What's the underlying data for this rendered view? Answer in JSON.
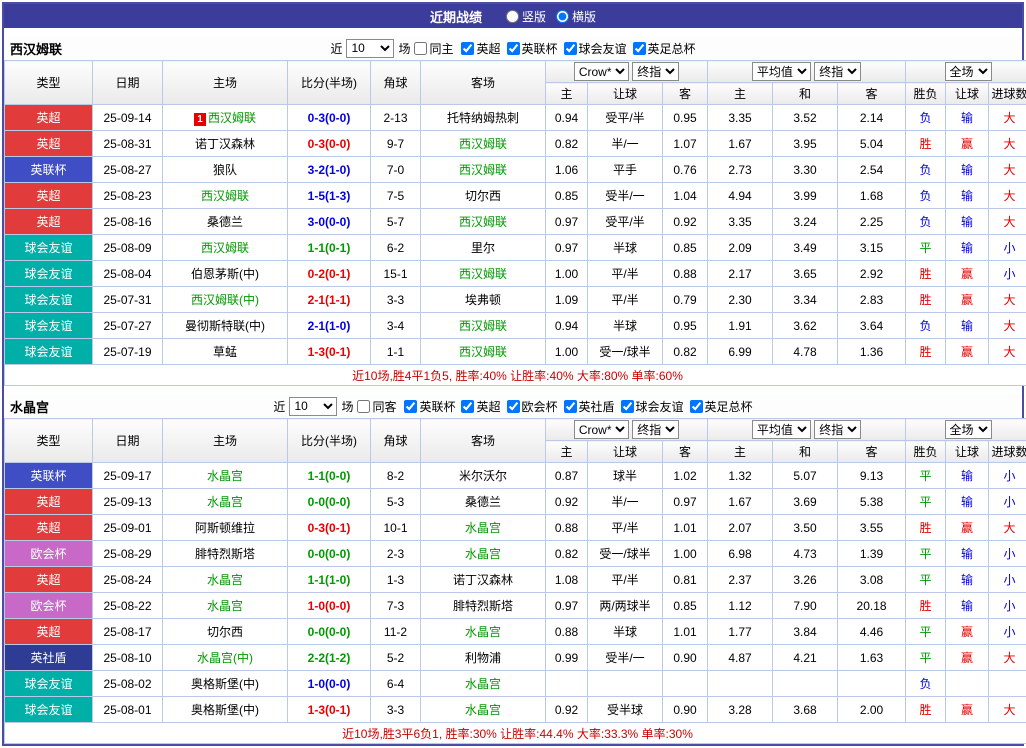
{
  "titlebar": {
    "title": "近期战绩",
    "layout_options": [
      {
        "label": "竖版",
        "selected": false
      },
      {
        "label": "横版",
        "selected": true
      }
    ]
  },
  "controls": {
    "near": "近",
    "count": "10",
    "matches": "场",
    "odds_source": "Crow*",
    "final_index": "终指",
    "average": "平均值",
    "full_match": "全场"
  },
  "columns": {
    "type": "类型",
    "date": "日期",
    "home": "主场",
    "score": "比分(半场)",
    "corner": "角球",
    "away": "客场",
    "odds_home": "主",
    "handicap": "让球",
    "odds_away": "客",
    "avg_home": "主",
    "avg_draw": "和",
    "avg_away": "客",
    "result": "胜负",
    "handicap_result": "让球",
    "goals": "进球数"
  },
  "colors": {
    "type": {
      "英超": "#e13b3b",
      "英联杯": "#3f4ec4",
      "球会友谊": "#00b0a8",
      "欧会杯": "#c869c8",
      "英社盾": "#2e3c96"
    },
    "outcome": {
      "win": "#e60000",
      "draw": "#009900",
      "loss": "#0000e0"
    },
    "mark": {
      "胜": "#e60000",
      "平": "#009900",
      "负": "#0000e0",
      "赢": "#e60000",
      "输": "#0000e0",
      "大": "#e60000",
      "小": "#0000e0"
    }
  },
  "sections": [
    {
      "team": "西汉姆联",
      "same_label": "同主",
      "filters": [
        "英超",
        "英联杯",
        "球会友谊",
        "英足总杯"
      ],
      "rows": [
        {
          "type": "英超",
          "date": "25-09-14",
          "home": "西汉姆联",
          "home_focus": true,
          "home_badge": "1",
          "score": "0-3(0-0)",
          "outcome": "loss",
          "corner": "2-13",
          "away": "托特纳姆热刺",
          "away_focus": false,
          "o_home": "0.94",
          "hcap": "受平/半",
          "o_away": "0.95",
          "avg_home": "3.35",
          "avg_draw": "3.52",
          "avg_away": "2.14",
          "res": "负",
          "hres": "输",
          "goals": "大"
        },
        {
          "type": "英超",
          "date": "25-08-31",
          "home": "诺丁汉森林",
          "home_focus": false,
          "score": "0-3(0-0)",
          "outcome": "win",
          "corner": "9-7",
          "away": "西汉姆联",
          "away_focus": true,
          "o_home": "0.82",
          "hcap": "半/一",
          "o_away": "1.07",
          "avg_home": "1.67",
          "avg_draw": "3.95",
          "avg_away": "5.04",
          "res": "胜",
          "hres": "赢",
          "goals": "大"
        },
        {
          "type": "英联杯",
          "date": "25-08-27",
          "home": "狼队",
          "home_focus": false,
          "score": "3-2(1-0)",
          "outcome": "loss",
          "corner": "7-0",
          "away": "西汉姆联",
          "away_focus": true,
          "o_home": "1.06",
          "hcap": "平手",
          "o_away": "0.76",
          "avg_home": "2.73",
          "avg_draw": "3.30",
          "avg_away": "2.54",
          "res": "负",
          "hres": "输",
          "goals": "大"
        },
        {
          "type": "英超",
          "date": "25-08-23",
          "home": "西汉姆联",
          "home_focus": true,
          "score": "1-5(1-3)",
          "outcome": "loss",
          "corner": "7-5",
          "away": "切尔西",
          "away_focus": false,
          "o_home": "0.85",
          "hcap": "受半/一",
          "o_away": "1.04",
          "avg_home": "4.94",
          "avg_draw": "3.99",
          "avg_away": "1.68",
          "res": "负",
          "hres": "输",
          "goals": "大"
        },
        {
          "type": "英超",
          "date": "25-08-16",
          "home": "桑德兰",
          "home_focus": false,
          "score": "3-0(0-0)",
          "outcome": "loss",
          "corner": "5-7",
          "away": "西汉姆联",
          "away_focus": true,
          "o_home": "0.97",
          "hcap": "受平/半",
          "o_away": "0.92",
          "avg_home": "3.35",
          "avg_draw": "3.24",
          "avg_away": "2.25",
          "res": "负",
          "hres": "输",
          "goals": "大"
        },
        {
          "type": "球会友谊",
          "date": "25-08-09",
          "home": "西汉姆联",
          "home_focus": true,
          "score": "1-1(0-1)",
          "outcome": "draw",
          "corner": "6-2",
          "away": "里尔",
          "away_focus": false,
          "o_home": "0.97",
          "hcap": "半球",
          "o_away": "0.85",
          "avg_home": "2.09",
          "avg_draw": "3.49",
          "avg_away": "3.15",
          "res": "平",
          "hres": "输",
          "goals": "小"
        },
        {
          "type": "球会友谊",
          "date": "25-08-04",
          "home": "伯恩茅斯(中)",
          "home_focus": false,
          "score": "0-2(0-1)",
          "outcome": "win",
          "corner": "15-1",
          "away": "西汉姆联",
          "away_focus": true,
          "o_home": "1.00",
          "hcap": "平/半",
          "o_away": "0.88",
          "avg_home": "2.17",
          "avg_draw": "3.65",
          "avg_away": "2.92",
          "res": "胜",
          "hres": "赢",
          "goals": "小"
        },
        {
          "type": "球会友谊",
          "date": "25-07-31",
          "home": "西汉姆联(中)",
          "home_focus": true,
          "score": "2-1(1-1)",
          "outcome": "win",
          "corner": "3-3",
          "away": "埃弗顿",
          "away_focus": false,
          "o_home": "1.09",
          "hcap": "平/半",
          "o_away": "0.79",
          "avg_home": "2.30",
          "avg_draw": "3.34",
          "avg_away": "2.83",
          "res": "胜",
          "hres": "赢",
          "goals": "大"
        },
        {
          "type": "球会友谊",
          "date": "25-07-27",
          "home": "曼彻斯特联(中)",
          "home_focus": false,
          "score": "2-1(1-0)",
          "outcome": "loss",
          "corner": "3-4",
          "away": "西汉姆联",
          "away_focus": true,
          "o_home": "0.94",
          "hcap": "半球",
          "o_away": "0.95",
          "avg_home": "1.91",
          "avg_draw": "3.62",
          "avg_away": "3.64",
          "res": "负",
          "hres": "输",
          "goals": "大"
        },
        {
          "type": "球会友谊",
          "date": "25-07-19",
          "home": "草蜢",
          "home_focus": false,
          "score": "1-3(0-1)",
          "outcome": "win",
          "corner": "1-1",
          "away": "西汉姆联",
          "away_focus": true,
          "o_home": "1.00",
          "hcap": "受一/球半",
          "o_away": "0.82",
          "avg_home": "6.99",
          "avg_draw": "4.78",
          "avg_away": "1.36",
          "res": "胜",
          "hres": "赢",
          "goals": "大"
        }
      ],
      "summary": "近10场,胜4平1负5, 胜率:40% 让胜率:40% 大率:80% 单率:60%"
    },
    {
      "team": "水晶宫",
      "same_label": "同客",
      "filters": [
        "英联杯",
        "英超",
        "欧会杯",
        "英社盾",
        "球会友谊",
        "英足总杯"
      ],
      "rows": [
        {
          "type": "英联杯",
          "date": "25-09-17",
          "home": "水晶宫",
          "home_focus": true,
          "score": "1-1(0-0)",
          "outcome": "draw",
          "corner": "8-2",
          "away": "米尔沃尔",
          "away_focus": false,
          "o_home": "0.87",
          "hcap": "球半",
          "o_away": "1.02",
          "avg_home": "1.32",
          "avg_draw": "5.07",
          "avg_away": "9.13",
          "res": "平",
          "hres": "输",
          "goals": "小"
        },
        {
          "type": "英超",
          "date": "25-09-13",
          "home": "水晶宫",
          "home_focus": true,
          "score": "0-0(0-0)",
          "outcome": "draw",
          "corner": "5-3",
          "away": "桑德兰",
          "away_focus": false,
          "o_home": "0.92",
          "hcap": "半/一",
          "o_away": "0.97",
          "avg_home": "1.67",
          "avg_draw": "3.69",
          "avg_away": "5.38",
          "res": "平",
          "hres": "输",
          "goals": "小"
        },
        {
          "type": "英超",
          "date": "25-09-01",
          "home": "阿斯顿维拉",
          "home_focus": false,
          "score": "0-3(0-1)",
          "outcome": "win",
          "corner": "10-1",
          "away": "水晶宫",
          "away_focus": true,
          "o_home": "0.88",
          "hcap": "平/半",
          "o_away": "1.01",
          "avg_home": "2.07",
          "avg_draw": "3.50",
          "avg_away": "3.55",
          "res": "胜",
          "hres": "赢",
          "goals": "大"
        },
        {
          "type": "欧会杯",
          "date": "25-08-29",
          "home": "腓特烈斯塔",
          "home_focus": false,
          "score": "0-0(0-0)",
          "outcome": "draw",
          "corner": "2-3",
          "away": "水晶宫",
          "away_focus": true,
          "o_home": "0.82",
          "hcap": "受一/球半",
          "o_away": "1.00",
          "avg_home": "6.98",
          "avg_draw": "4.73",
          "avg_away": "1.39",
          "res": "平",
          "hres": "输",
          "goals": "小"
        },
        {
          "type": "英超",
          "date": "25-08-24",
          "home": "水晶宫",
          "home_focus": true,
          "score": "1-1(1-0)",
          "outcome": "draw",
          "corner": "1-3",
          "away": "诺丁汉森林",
          "away_focus": false,
          "o_home": "1.08",
          "hcap": "平/半",
          "o_away": "0.81",
          "avg_home": "2.37",
          "avg_draw": "3.26",
          "avg_away": "3.08",
          "res": "平",
          "hres": "输",
          "goals": "小"
        },
        {
          "type": "欧会杯",
          "date": "25-08-22",
          "home": "水晶宫",
          "home_focus": true,
          "score": "1-0(0-0)",
          "outcome": "win",
          "corner": "7-3",
          "away": "腓特烈斯塔",
          "away_focus": false,
          "o_home": "0.97",
          "hcap": "两/两球半",
          "o_away": "0.85",
          "avg_home": "1.12",
          "avg_draw": "7.90",
          "avg_away": "20.18",
          "res": "胜",
          "hres": "输",
          "goals": "小"
        },
        {
          "type": "英超",
          "date": "25-08-17",
          "home": "切尔西",
          "home_focus": false,
          "score": "0-0(0-0)",
          "outcome": "draw",
          "corner": "11-2",
          "away": "水晶宫",
          "away_focus": true,
          "o_home": "0.88",
          "hcap": "半球",
          "o_away": "1.01",
          "avg_home": "1.77",
          "avg_draw": "3.84",
          "avg_away": "4.46",
          "res": "平",
          "hres": "赢",
          "goals": "小"
        },
        {
          "type": "英社盾",
          "date": "25-08-10",
          "home": "水晶宫(中)",
          "home_focus": true,
          "score": "2-2(1-2)",
          "outcome": "draw",
          "corner": "5-2",
          "away": "利物浦",
          "away_focus": false,
          "o_home": "0.99",
          "hcap": "受半/一",
          "o_away": "0.90",
          "avg_home": "4.87",
          "avg_draw": "4.21",
          "avg_away": "1.63",
          "res": "平",
          "hres": "赢",
          "goals": "大"
        },
        {
          "type": "球会友谊",
          "date": "25-08-02",
          "home": "奥格斯堡(中)",
          "home_focus": false,
          "score": "1-0(0-0)",
          "outcome": "loss",
          "corner": "6-4",
          "away": "水晶宫",
          "away_focus": true,
          "o_home": "",
          "hcap": "",
          "o_away": "",
          "avg_home": "",
          "avg_draw": "",
          "avg_away": "",
          "res": "负",
          "hres": "",
          "goals": ""
        },
        {
          "type": "球会友谊",
          "date": "25-08-01",
          "home": "奥格斯堡(中)",
          "home_focus": false,
          "score": "1-3(0-1)",
          "outcome": "win",
          "corner": "3-3",
          "away": "水晶宫",
          "away_focus": true,
          "o_home": "0.92",
          "hcap": "受半球",
          "o_away": "0.90",
          "avg_home": "3.28",
          "avg_draw": "3.68",
          "avg_away": "2.00",
          "res": "胜",
          "hres": "赢",
          "goals": "大"
        }
      ],
      "summary": "近10场,胜3平6负1, 胜率:30% 让胜率:44.4% 大率:33.3% 单率:30%"
    }
  ]
}
